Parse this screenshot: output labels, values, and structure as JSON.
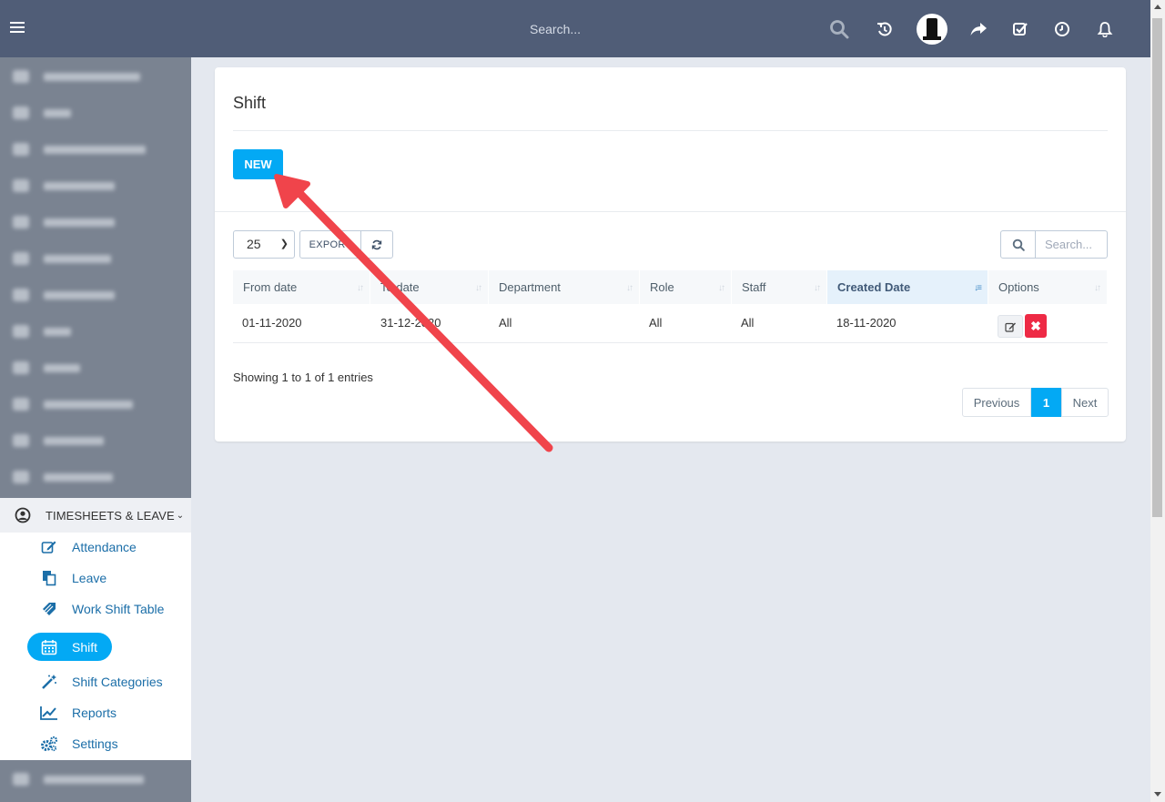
{
  "topbar": {
    "search_placeholder": "Search...",
    "icons": [
      "menu-icon",
      "search-icon",
      "history-icon",
      "avatar",
      "share-icon",
      "checklist-icon",
      "clock-icon",
      "bell-icon"
    ]
  },
  "sidebar": {
    "section_label": "TIMESHEETS & LEAVE",
    "items": [
      {
        "label": "Attendance",
        "icon": "edit-icon"
      },
      {
        "label": "Leave",
        "icon": "copy-icon"
      },
      {
        "label": "Work Shift Table",
        "icon": "tag-icon"
      },
      {
        "label": "Shift",
        "icon": "calendar-icon",
        "active": true
      },
      {
        "label": "Shift Categories",
        "icon": "magic-wand-icon"
      },
      {
        "label": "Reports",
        "icon": "line-chart-icon"
      },
      {
        "label": "Settings",
        "icon": "gears-icon"
      }
    ]
  },
  "main": {
    "title": "Shift",
    "new_button": "NEW",
    "page_length": "25",
    "export_button": "EXPORT",
    "search_placeholder": "Search...",
    "table": {
      "columns": [
        "From date",
        "To date",
        "Department",
        "Role",
        "Staff",
        "Created Date",
        "Options"
      ],
      "sorted_column": "Created Date",
      "rows": [
        {
          "from_date": "01-11-2020",
          "to_date": "31-12-2020",
          "department": "All",
          "role": "All",
          "staff": "All",
          "created_date": "18-11-2020"
        }
      ]
    },
    "info": "Showing 1 to 1 of 1 entries",
    "pagination": {
      "previous": "Previous",
      "current": "1",
      "next": "Next"
    }
  },
  "colors": {
    "topbar": "#505d77",
    "accent": "#03a9f4",
    "danger": "#ee2a45",
    "arrow": "#f0444b"
  }
}
